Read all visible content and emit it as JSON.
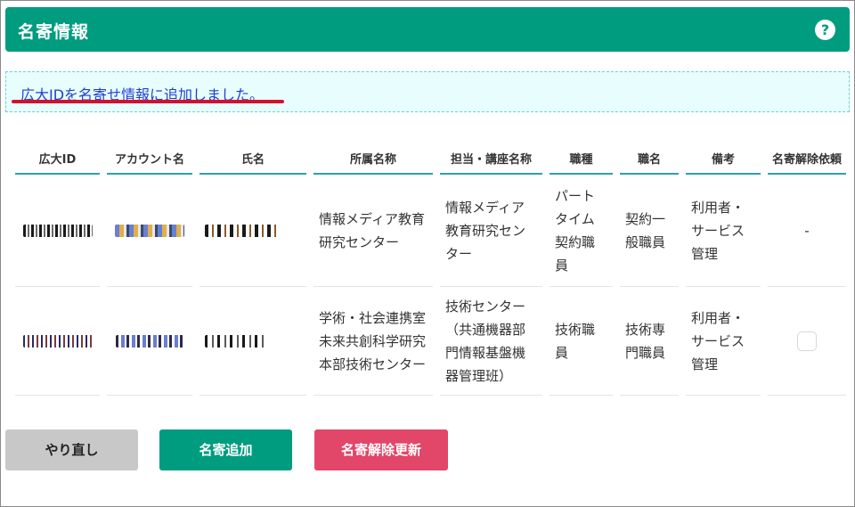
{
  "header": {
    "title": "名寄情報",
    "help_icon": "question-circle-icon"
  },
  "notice": {
    "text": "広大IDを名寄せ情報に追加しました。"
  },
  "table": {
    "columns": [
      "広大ID",
      "アカウント名",
      "氏名",
      "所属名称",
      "担当・講座名称",
      "職種",
      "職名",
      "備考",
      "名寄解除依頼"
    ],
    "rows": [
      {
        "affiliation": "情報メディア教育研究センター",
        "department": "情報メディア教育研究センター",
        "job_type": "パートタイム契約職員",
        "title": "契約一般職員",
        "remarks": "利用者・サービス管理",
        "release": "-"
      },
      {
        "affiliation": "学術・社会連携室未来共創科学研究本部技術センター",
        "department": "技術センター（共通機器部門情報基盤機器管理班）",
        "job_type": "技術職員",
        "title": "技術専門職員",
        "remarks": "利用者・サービス管理",
        "release": ""
      }
    ]
  },
  "buttons": {
    "redo": "やり直し",
    "add": "名寄追加",
    "update": "名寄解除更新"
  },
  "colors": {
    "accent": "#009c7f",
    "danger": "#e24668",
    "neutral": "#c8c8c8",
    "link": "#1d3fd2"
  }
}
